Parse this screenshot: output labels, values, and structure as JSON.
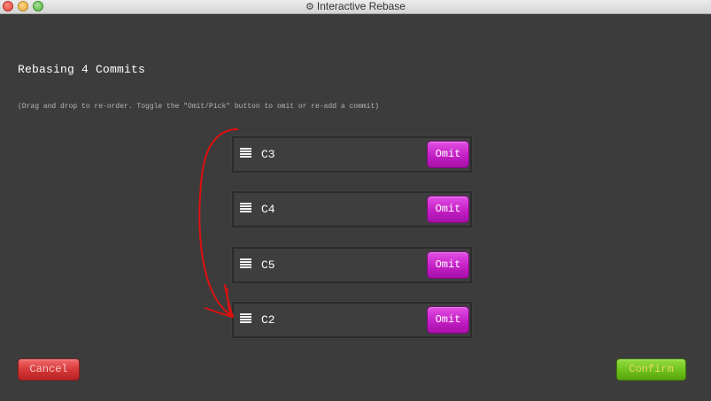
{
  "window": {
    "title": "Interactive Rebase",
    "title_icon": "gear-icon"
  },
  "header": {
    "heading": "Rebasing 4 Commits",
    "hint": "(Drag and drop to re-order. Toggle the \"Omit/Pick\" button to omit or re-add a commit)"
  },
  "commits": [
    {
      "label": "C3",
      "button": "Omit"
    },
    {
      "label": "C4",
      "button": "Omit"
    },
    {
      "label": "C5",
      "button": "Omit"
    },
    {
      "label": "C2",
      "button": "Omit"
    }
  ],
  "footer": {
    "cancel_label": "Cancel",
    "confirm_label": "Confirm"
  },
  "colors": {
    "background": "#3c3c3c",
    "omit_button": "#c31fc4",
    "cancel_button": "#d33535",
    "confirm_button": "#6fc11c",
    "annotation_arrow": "#e01010"
  },
  "annotation": {
    "type": "hand-drawn-arrow",
    "from_commit": "C3",
    "to_commit": "C2"
  }
}
